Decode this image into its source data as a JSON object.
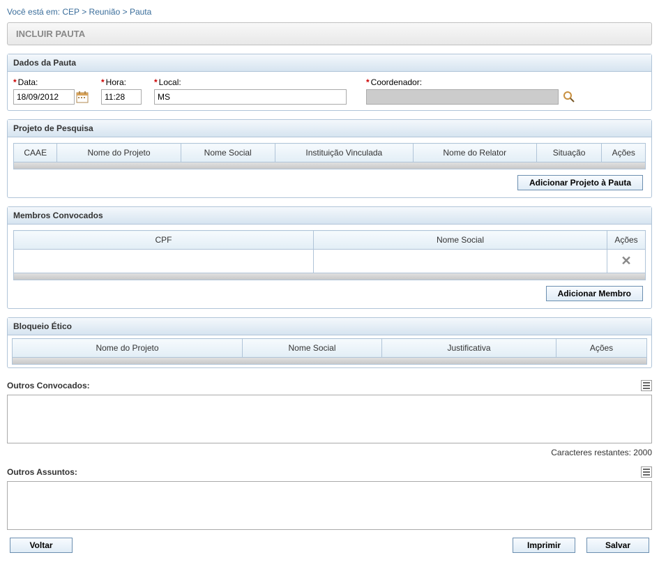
{
  "breadcrumb": {
    "prefix": "Você está em:",
    "p1": "CEP",
    "p2": "Reunião",
    "p3": "Pauta",
    "sep": " > "
  },
  "page_title": "INCLUIR PAUTA",
  "dados": {
    "title": "Dados da Pauta",
    "data_label": "Data:",
    "data_value": "18/09/2012",
    "hora_label": "Hora:",
    "hora_value": "11:28",
    "local_label": "Local:",
    "local_value": "MS",
    "coord_label": "Coordenador:",
    "coord_value": ""
  },
  "projeto": {
    "title": "Projeto de Pesquisa",
    "cols": {
      "caae": "CAAE",
      "nome_projeto": "Nome do Projeto",
      "nome_social": "Nome Social",
      "instituicao": "Instituição Vinculada",
      "relator": "Nome do Relator",
      "situacao": "Situação",
      "acoes": "Ações"
    },
    "add_btn": "Adicionar Projeto à Pauta"
  },
  "membros": {
    "title": "Membros Convocados",
    "cols": {
      "cpf": "CPF",
      "nome_social": "Nome Social",
      "acoes": "Ações"
    },
    "add_btn": "Adicionar Membro"
  },
  "bloqueio": {
    "title": "Bloqueio Ético",
    "cols": {
      "nome_projeto": "Nome do Projeto",
      "nome_social": "Nome Social",
      "justificativa": "Justificativa",
      "acoes": "Ações"
    }
  },
  "outros_convocados": {
    "label": "Outros Convocados:",
    "value": "",
    "char_label": "Caracteres restantes:",
    "char_count": "2000"
  },
  "outros_assuntos": {
    "label": "Outros Assuntos:",
    "value": ""
  },
  "buttons": {
    "voltar": "Voltar",
    "imprimir": "Imprimir",
    "salvar": "Salvar"
  }
}
